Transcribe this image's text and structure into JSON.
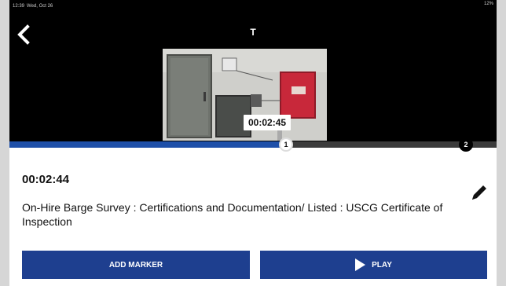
{
  "status_bar": {
    "time": "12:39",
    "date": "Wed, Oct 26",
    "battery": "12%"
  },
  "header": {
    "title": "T",
    "back_icon": "chevron-left-icon"
  },
  "video": {
    "current_timecode": "00:02:45"
  },
  "timeline": {
    "progress_fraction": 0.57,
    "markers": [
      {
        "label": "1",
        "position_fraction": 0.57
      },
      {
        "label": "2",
        "position_fraction": 0.94
      }
    ]
  },
  "marker_detail": {
    "timestamp": "00:02:44",
    "description": "On-Hire Barge Survey : Certifications and Documentation/ Listed : USCG Certificate of Inspection",
    "edit_icon": "pencil-icon"
  },
  "actions": {
    "add_marker_label": "ADD MARKER",
    "play_label": "PLAY",
    "play_icon": "play-icon"
  },
  "colors": {
    "primary": "#1e3f8f",
    "timeline_fill": "#1e4fa8"
  }
}
